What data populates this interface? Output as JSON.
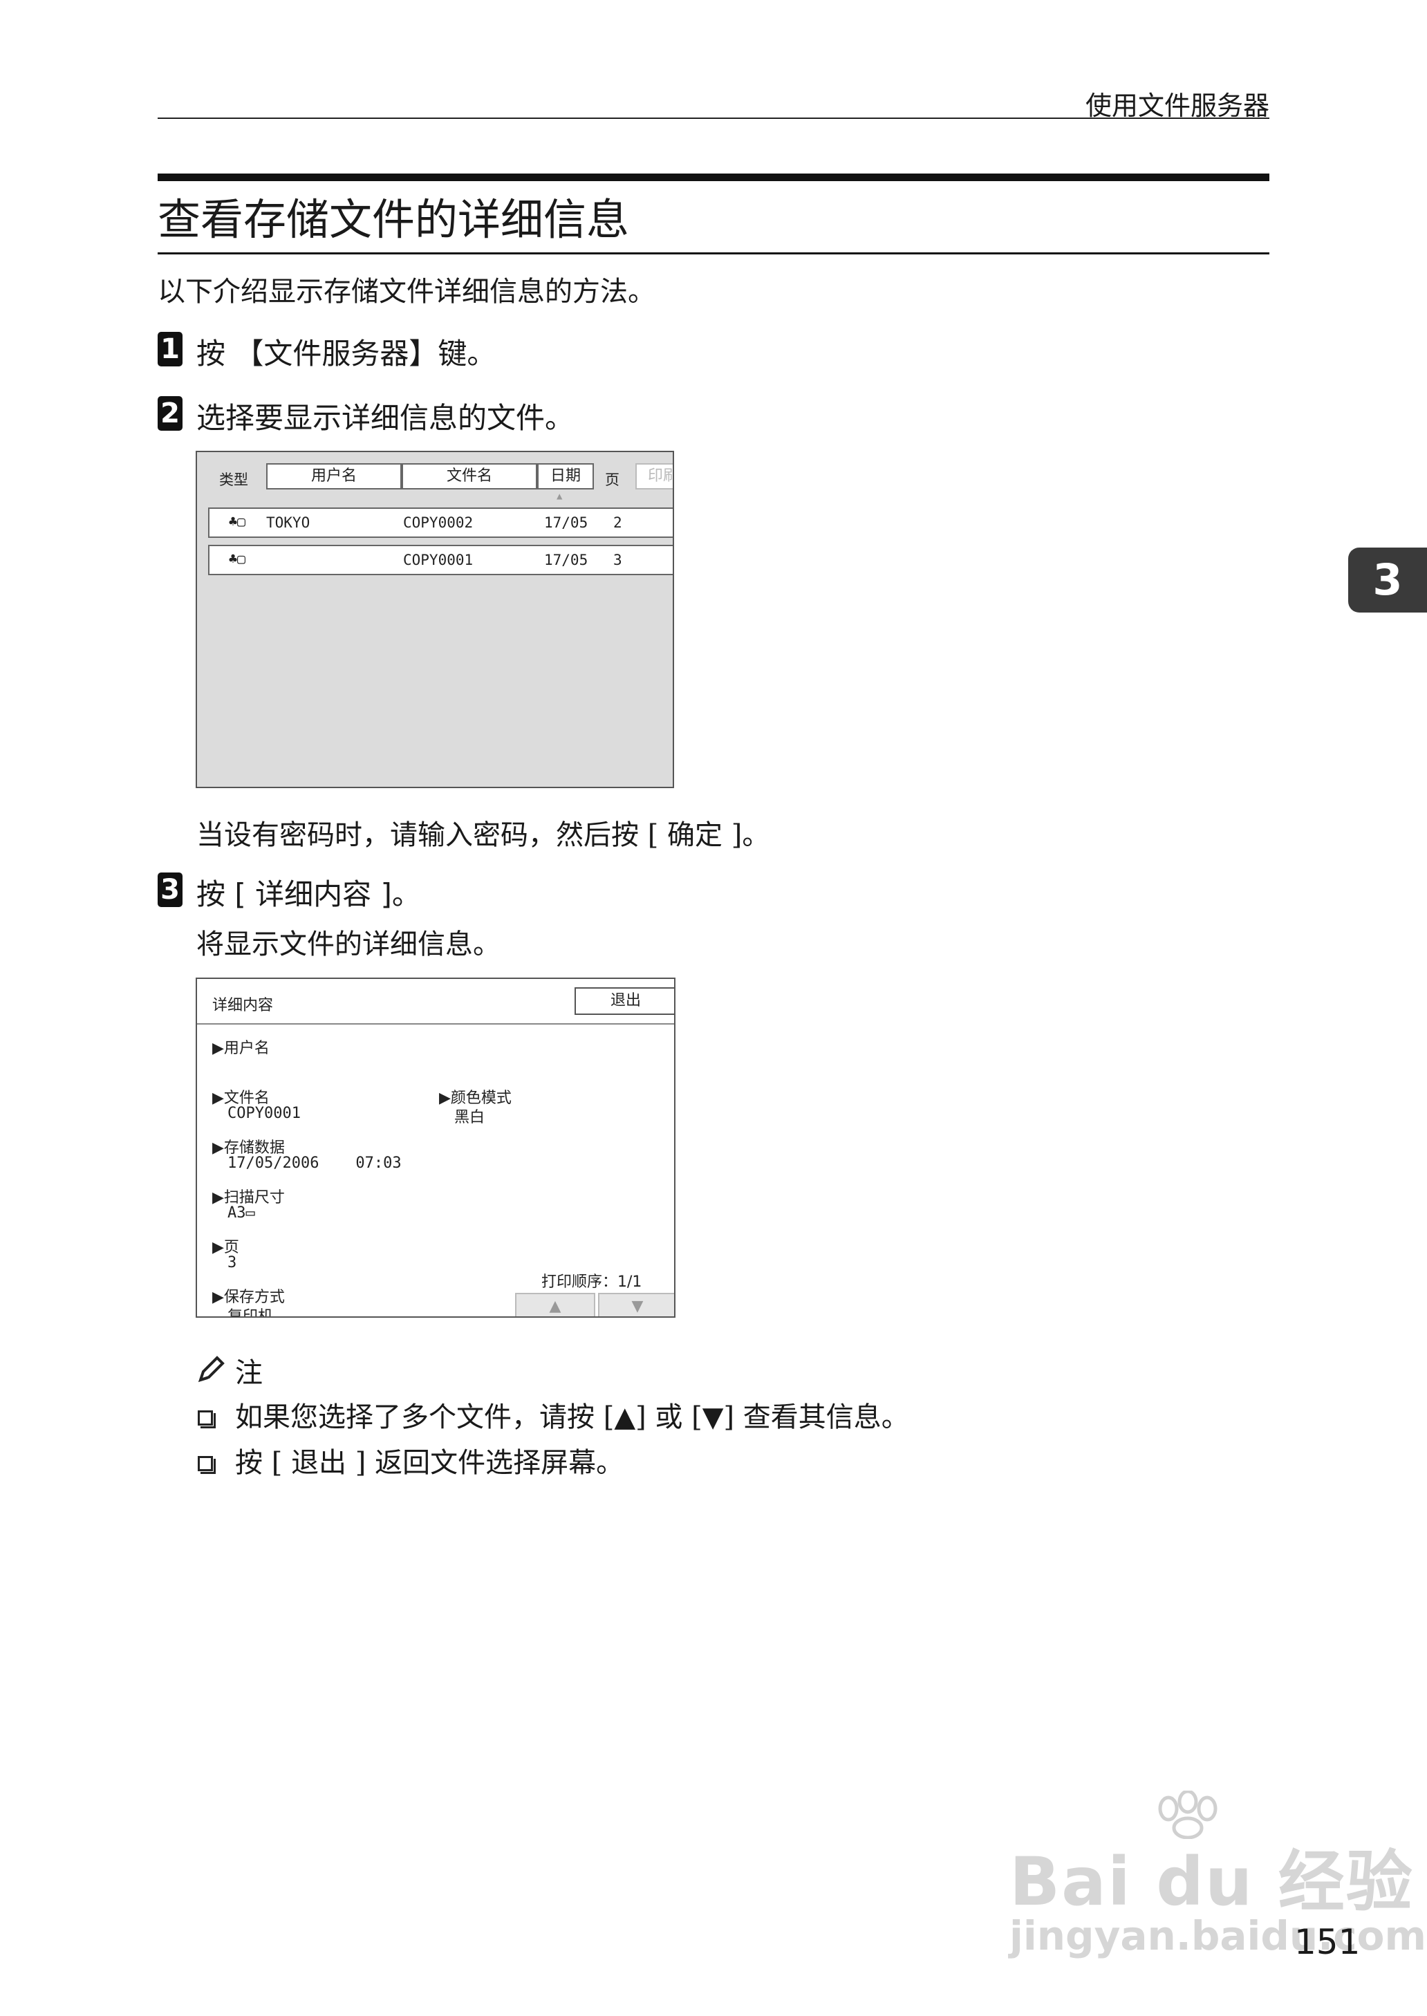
{
  "header": {
    "section": "使用文件服务器"
  },
  "title": "查看存储文件的详细信息",
  "intro": "以下介绍显示存储文件详细信息的方法。",
  "chapter_tab": "3",
  "steps": [
    {
      "number": "1",
      "text": "按 【文件服务器】键。"
    },
    {
      "number": "2",
      "text": "选择要显示详细信息的文件。"
    },
    {
      "number": "3",
      "text": "按 [ 详细内容 ]。"
    }
  ],
  "step2_note": "当设有密码时，请输入密码，然后按 [ 确定 ]。",
  "step3_result": "将显示文件的详细信息。",
  "file_list_screen": {
    "type_label": "类型",
    "columns": [
      "用户名",
      "文件名",
      "日期",
      "页",
      "印刷"
    ],
    "rows": [
      {
        "user": "TOKYO",
        "file": "COPY0002",
        "date": "17/05",
        "pages": "2"
      },
      {
        "user": "",
        "file": "COPY0001",
        "date": "17/05",
        "pages": "3"
      }
    ]
  },
  "details_screen": {
    "title": "详细内容",
    "exit_button": "退出",
    "user_name_label": "▶用户名",
    "file_name_label": "▶文件名",
    "file_name_value": "COPY0001",
    "color_mode_label": "▶颜色模式",
    "color_mode_value": "黑白",
    "stored_label": "▶存储数据",
    "stored_value": "17/05/2006    07:03",
    "scan_size_label": "▶扫描尺寸",
    "scan_size_value": "A3",
    "pages_label": "▶页",
    "pages_value": "3",
    "save_method_label": "▶保存方式",
    "save_method_value": "复印机",
    "print_order": "打印顺序：1/1",
    "up_arrow": "▲",
    "down_arrow": "▼"
  },
  "note": {
    "heading": "注",
    "items": [
      "如果您选择了多个文件，请按 [▲] 或 [▼] 查看其信息。",
      "按 [ 退出 ] 返回文件选择屏幕。"
    ]
  },
  "watermark": {
    "brand": "Bai du 经验",
    "url": "jingyan.baidu.com"
  },
  "page_number": "151"
}
